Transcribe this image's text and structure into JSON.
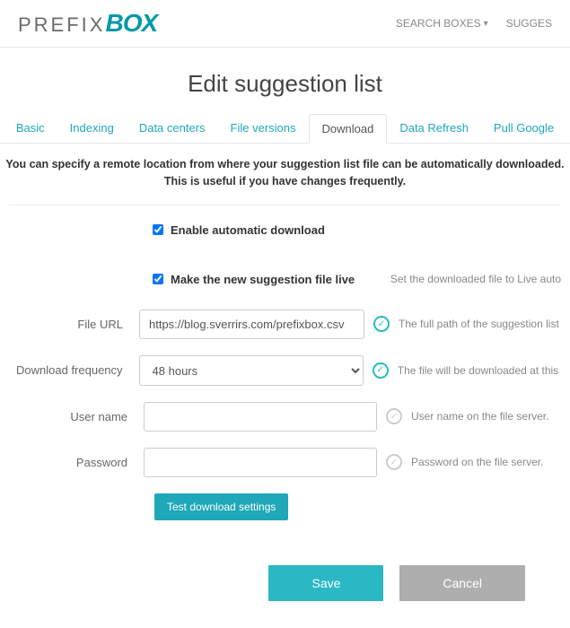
{
  "logo": {
    "prefix": "PREFIX",
    "box": "BOX"
  },
  "nav": {
    "search_boxes": "SEARCH BOXES",
    "sugges": "SUGGES"
  },
  "page_title": "Edit suggestion list",
  "tabs": {
    "basic": "Basic",
    "indexing": "Indexing",
    "data_centers": "Data centers",
    "file_versions": "File versions",
    "download": "Download",
    "data_refresh": "Data Refresh",
    "pull_google": "Pull Google"
  },
  "description": "You can specify a remote location from where your suggestion list file can be automatically downloaded. This is useful if you have changes frequently.",
  "form": {
    "enable_auto_label": "Enable automatic download",
    "make_live_label": "Make the new suggestion file live",
    "make_live_help": "Set the downloaded file to Live auto",
    "file_url_label": "File URL",
    "file_url_value": "https://blog.sverrirs.com/prefixbox.csv",
    "file_url_help": "The full path of the suggestion list fi",
    "freq_label": "Download frequency",
    "freq_value": "48 hours",
    "freq_help": "The file will be downloaded at this fr",
    "username_label": "User name",
    "username_value": "",
    "username_help": "User name on the file server.",
    "password_label": "Password",
    "password_value": "",
    "password_help": "Password on the file server.",
    "test_btn": "Test download settings"
  },
  "buttons": {
    "save": "Save",
    "cancel": "Cancel"
  }
}
